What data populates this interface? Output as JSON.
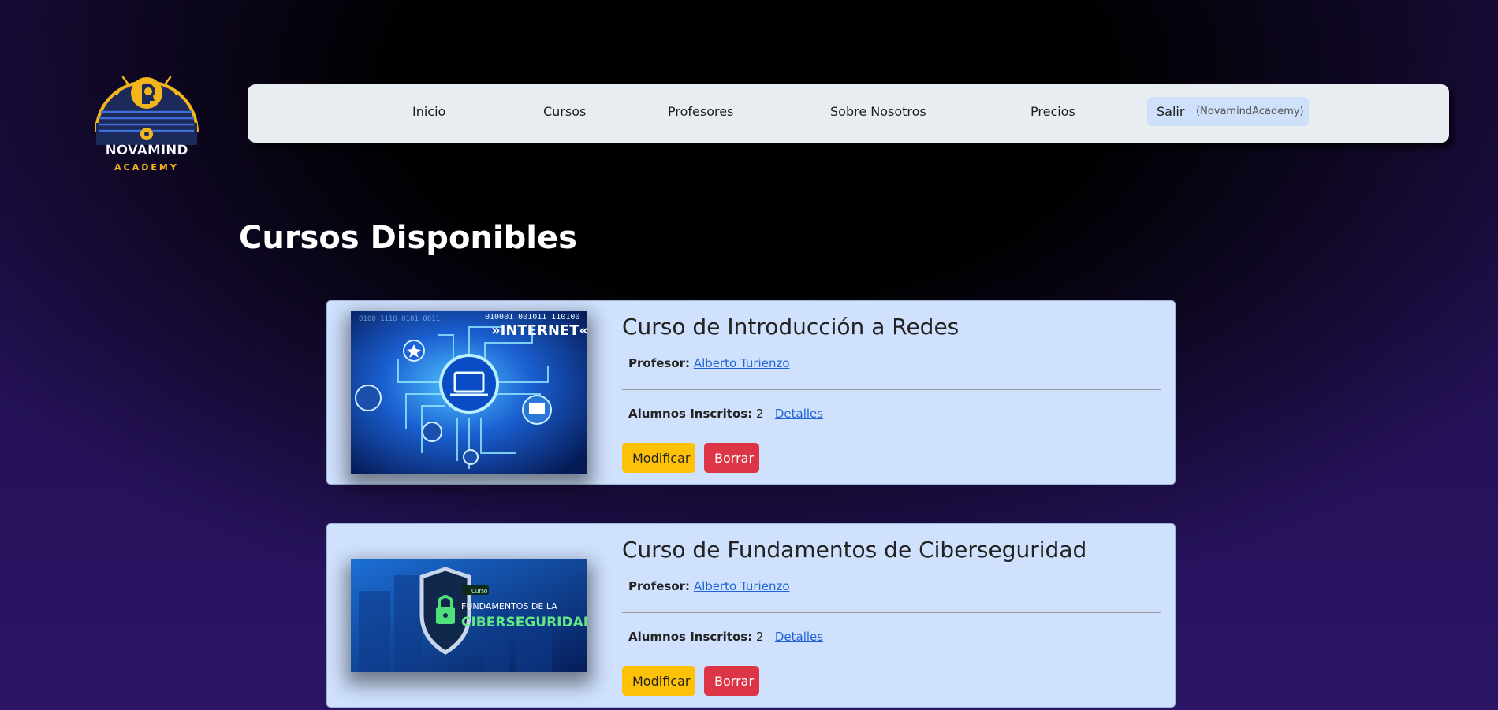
{
  "logo": {
    "name": "NOVAMIND",
    "sub": "ACADEMY"
  },
  "nav": {
    "items": [
      "Inicio",
      "Cursos",
      "Profesores",
      "Sobre Nosotros",
      "Precios"
    ],
    "logout_label": "Salir",
    "user": "(NovamindAcademy)"
  },
  "page": {
    "title": "Cursos Disponibles"
  },
  "labels": {
    "profesor": "Profesor:",
    "alumnos": "Alumnos Inscritos:",
    "detalles": "Detalles",
    "modificar": "Modificar",
    "borrar": "Borrar"
  },
  "courses": [
    {
      "title": "Curso de Introducción a Redes",
      "teacher": "Alberto Turienzo",
      "students": "2",
      "image_text": "»INTERNET«"
    },
    {
      "title": "Curso de Fundamentos de Ciberseguridad",
      "teacher": "Alberto Turienzo",
      "students": "2",
      "image_tag": "Curso",
      "image_line1": "FUNDAMENTOS DE LA",
      "image_line2": "CIBERSEGURIDAD"
    }
  ],
  "colors": {
    "modify": "#fdc107",
    "delete": "#dc3545",
    "card": "#cfe1fd",
    "logo_gold": "#f2b51c",
    "logo_navy": "#1c2a5b"
  },
  "icons": {
    "logo": "brain-head-icon",
    "course1": "laptop-network-icon",
    "course2": "shield-lock-icon"
  }
}
